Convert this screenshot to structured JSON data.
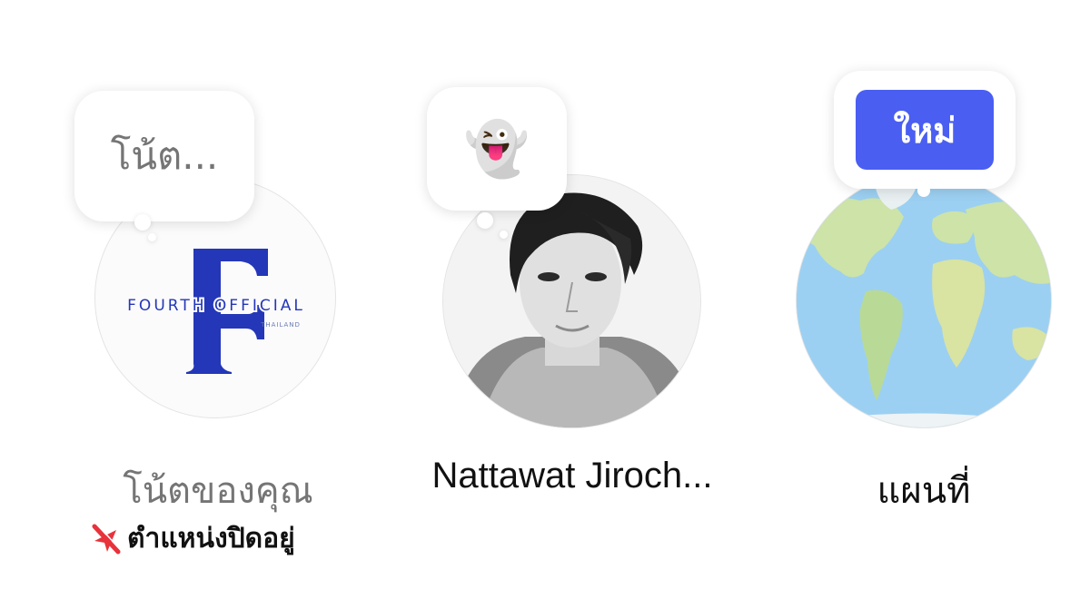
{
  "notes": [
    {
      "note_placeholder": "โน้ต...",
      "avatar_logo": {
        "letter": "F",
        "line1": "FOURTH OFFICIAL",
        "line2": "THAILAND"
      },
      "name": "โน้ตของคุณ",
      "location_status": "ตำแหน่งปิดอยู่",
      "location_icon": "location-off-icon"
    },
    {
      "note_emoji": "👻",
      "avatar_icon": "profile-photo",
      "name": "Nattawat Jiroch..."
    },
    {
      "badge": "ใหม่",
      "avatar_icon": "world-map",
      "name": "แผนที่"
    }
  ],
  "colors": {
    "badge_bg": "#4A5EF2",
    "logo_blue": "#2437B8",
    "location_off_red": "#E8323C",
    "map_ocean": "#9CD0F2",
    "map_land": "#CDE3A8"
  }
}
